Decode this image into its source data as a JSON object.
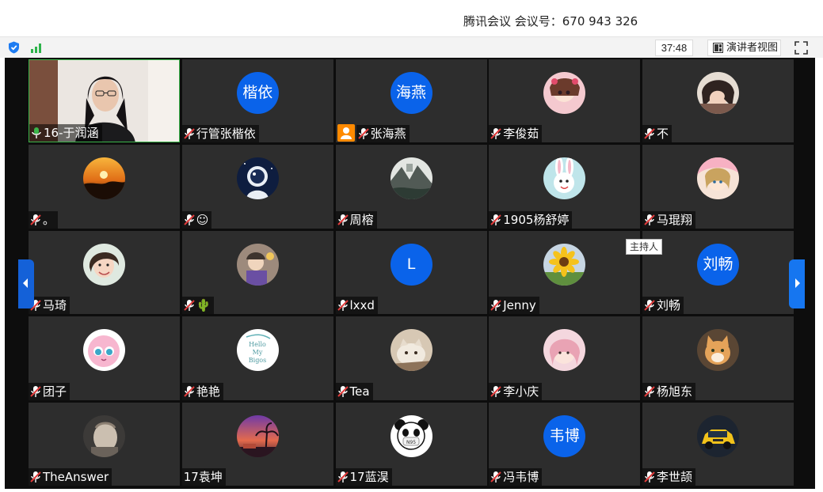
{
  "window": {
    "title": "腾讯会议 会议号：670 943 326"
  },
  "toolbar": {
    "timer": "37:48",
    "view_button": "演讲者视图",
    "icons": [
      "shield-icon",
      "signal-icon",
      "fullscreen-icon"
    ]
  },
  "tooltip": "主持人",
  "colors": {
    "avatar_blue": "#0a63ea",
    "tile_bg": "#2d2d2d",
    "grid_bg": "#0d0d0d",
    "host_orange": "#ff8a00",
    "mic_red": "#e23b3b",
    "mic_green": "#3bb54a",
    "nav_blue": "#1676f0"
  },
  "participants": [
    {
      "name": "16-于润涵",
      "avatar": "video",
      "mic": "active"
    },
    {
      "name": "行管张楷依",
      "avatar": "text",
      "avatar_text": "楷依",
      "mic": "muted"
    },
    {
      "name": "张海燕",
      "avatar": "text",
      "avatar_text": "海燕",
      "mic": "muted",
      "host_badge": true
    },
    {
      "name": "李俊茹",
      "avatar": "image",
      "image": "anime-girl-avatar",
      "mic": "muted"
    },
    {
      "name": "不",
      "avatar": "image",
      "image": "woman-portrait-avatar",
      "mic": "muted"
    },
    {
      "name": "。",
      "avatar": "image",
      "image": "sunset-avatar",
      "mic": "muted"
    },
    {
      "name": "☺",
      "avatar": "image",
      "image": "astronaut-avatar",
      "mic": "muted"
    },
    {
      "name": "周榕",
      "avatar": "image",
      "image": "landscape-avatar",
      "mic": "muted"
    },
    {
      "name": "1905杨舒婷",
      "avatar": "image",
      "image": "cartoon-rabbit-avatar",
      "mic": "muted"
    },
    {
      "name": "马琨翔",
      "avatar": "image",
      "image": "anime-illustration-avatar",
      "mic": "muted"
    },
    {
      "name": "马琦",
      "avatar": "image",
      "image": "girl-photo-avatar",
      "mic": "muted"
    },
    {
      "name": "🌵",
      "avatar": "image",
      "image": "character-avatar",
      "mic": "muted"
    },
    {
      "name": "lxxd",
      "avatar": "text",
      "avatar_text": "L",
      "mic": "muted"
    },
    {
      "name": "Jenny",
      "avatar": "image",
      "image": "sunflower-avatar",
      "mic": "muted"
    },
    {
      "name": "刘畅",
      "avatar": "text",
      "avatar_text": "刘畅",
      "mic": "muted"
    },
    {
      "name": "团子",
      "avatar": "image",
      "image": "pink-jigglypuff-avatar",
      "mic": "muted"
    },
    {
      "name": "艳艳",
      "avatar": "image",
      "image": "hello-my-bigos-avatar",
      "avatar_text": "Hello My Bigos",
      "mic": "muted"
    },
    {
      "name": "Tea",
      "avatar": "image",
      "image": "cat-avatar",
      "mic": "muted"
    },
    {
      "name": "李小庆",
      "avatar": "image",
      "image": "pink-girl-avatar",
      "mic": "muted"
    },
    {
      "name": "杨旭东",
      "avatar": "image",
      "image": "orange-cat-avatar",
      "mic": "muted"
    },
    {
      "name": "TheAnswer",
      "avatar": "image",
      "image": "sculpture-avatar",
      "mic": "muted"
    },
    {
      "name": "17袁坤",
      "avatar": "image",
      "image": "sunset-palm-avatar",
      "mic": "none"
    },
    {
      "name": "17蓝淏",
      "avatar": "image",
      "image": "panda-mask-avatar",
      "avatar_text": "N95",
      "mic": "muted"
    },
    {
      "name": "冯韦博",
      "avatar": "text",
      "avatar_text": "韦博",
      "mic": "muted"
    },
    {
      "name": "李世颉",
      "avatar": "image",
      "image": "yellow-car-avatar",
      "mic": "muted"
    }
  ]
}
